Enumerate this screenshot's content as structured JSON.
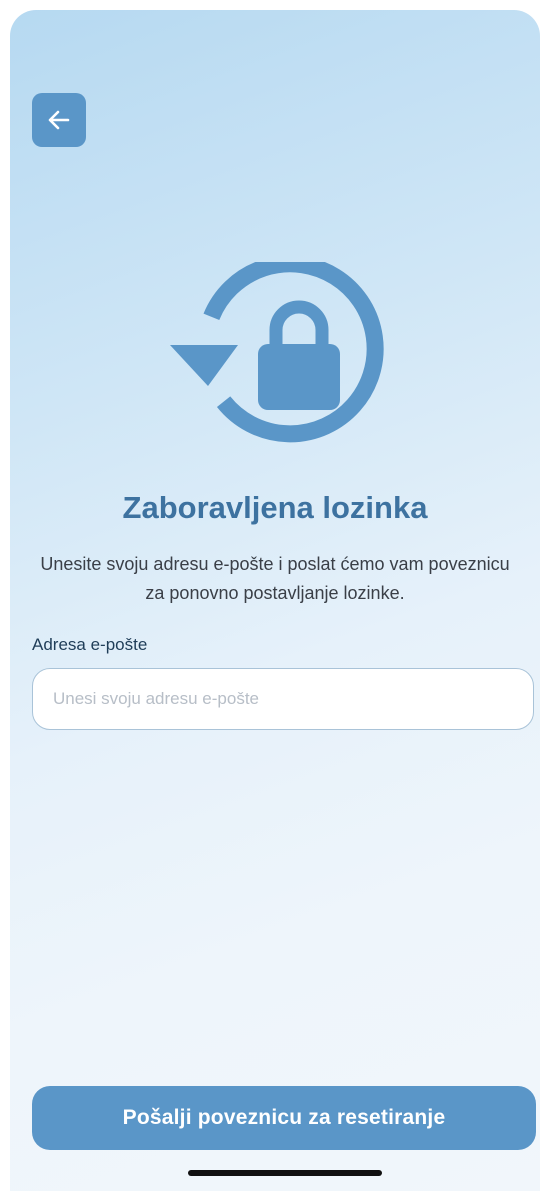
{
  "header": {
    "back_icon": "arrow-left-icon"
  },
  "hero": {
    "icon": "lock-reset-icon",
    "accent_color": "#5a96c8"
  },
  "content": {
    "title": "Zaboravljena lozinka",
    "subtitle": "Unesite svoju adresu e-pošte i poslat ćemo vam poveznicu za ponovno postavljanje lozinke."
  },
  "form": {
    "email_label": "Adresa e-pošte",
    "email_value": "",
    "email_placeholder": "Unesi svoju adresu e-pošte"
  },
  "actions": {
    "submit_label": "Pošalji poveznicu za resetiranje"
  },
  "colors": {
    "title": "#3d72a0",
    "button": "#5a96c8"
  }
}
